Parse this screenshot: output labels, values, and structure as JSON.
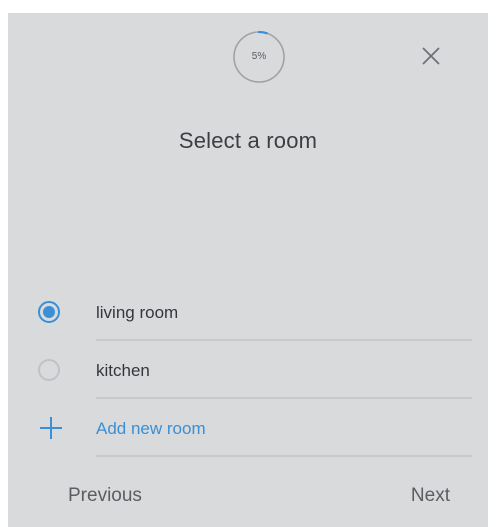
{
  "header": {
    "progress_label": "5%",
    "progress_value": 0.05
  },
  "title": "Select a room",
  "rooms": [
    {
      "label": "living room",
      "selected": true
    },
    {
      "label": "kitchen",
      "selected": false
    }
  ],
  "add_room_label": "Add new room",
  "footer": {
    "previous_label": "Previous",
    "next_label": "Next"
  },
  "colors": {
    "accent": "#3a8fd6",
    "background": "#d9dadc"
  },
  "icons": {
    "close": "close-icon",
    "add": "plus-icon"
  }
}
